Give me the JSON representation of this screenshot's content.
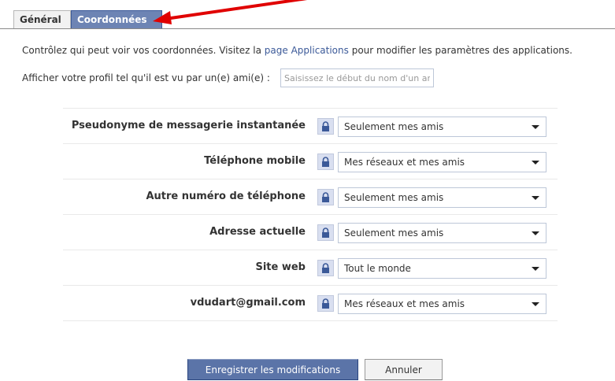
{
  "tabs": [
    {
      "label": "Général"
    },
    {
      "label": "Coordonnées"
    }
  ],
  "intro": {
    "before_link": "Contrôlez qui peut voir vos coordonnées. Visitez la ",
    "link": "page Applications",
    "after_link": " pour modifier les paramètres des applications."
  },
  "view_as": {
    "label": "Afficher votre profil tel qu'il est vu par un(e) ami(e) :",
    "placeholder": "Saisissez le début du nom d'un ami"
  },
  "rows": [
    {
      "label": "Pseudonyme de messagerie instantanée",
      "value": "Seulement mes amis"
    },
    {
      "label": "Téléphone mobile",
      "value": "Mes réseaux et mes amis"
    },
    {
      "label": "Autre numéro de téléphone",
      "value": "Seulement mes amis"
    },
    {
      "label": "Adresse actuelle",
      "value": "Seulement mes amis"
    },
    {
      "label": "Site web",
      "value": "Tout le monde"
    },
    {
      "label": "vdudart@gmail.com",
      "value": "Mes réseaux et mes amis"
    }
  ],
  "buttons": {
    "save": "Enregistrer les modifications",
    "cancel": "Annuler"
  },
  "colors": {
    "accent": "#3b5998",
    "active_tab": "#6d84b4",
    "annotation_arrow": "#e00000"
  },
  "icons": {
    "row_icon": "lock-icon",
    "select_icon": "caret-down-icon",
    "annotation": "red-arrow-annotation"
  }
}
